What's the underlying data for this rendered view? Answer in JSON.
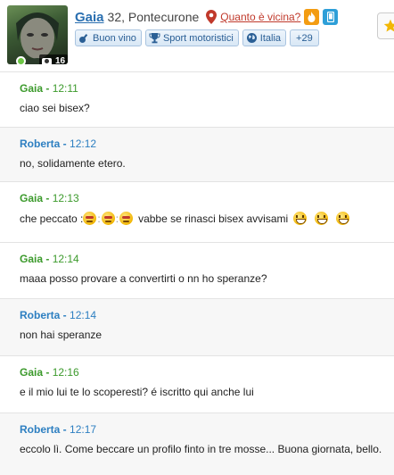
{
  "profile": {
    "username": "Gaia",
    "age_location": "32, Pontecurone",
    "nearby_link": "Quanto è vicina?",
    "photo_count": "16",
    "tags": [
      {
        "label": "Buon vino",
        "icon": "guitar-icon"
      },
      {
        "label": "Sport motoristici",
        "icon": "trophy-icon"
      },
      {
        "label": "Italia",
        "icon": "globe-icon"
      }
    ],
    "more_tags": "+29"
  },
  "colors": {
    "gaia": "#3c9a2c",
    "roberta": "#2d7fc1",
    "link": "#2a6fb0",
    "near_link": "#c0392b"
  },
  "messages": [
    {
      "sender": "Gaia",
      "time": "12:11",
      "text": "ciao sei bisex?"
    },
    {
      "sender": "Roberta",
      "time": "12:12",
      "text": "no, solidamente etero."
    },
    {
      "sender": "Gaia",
      "time": "12:13",
      "text_a": "che peccato :",
      "colon": ":",
      "text_b": "vabbe se rinasci bisex avvisami"
    },
    {
      "sender": "Gaia",
      "time": "12:14",
      "text": "maaa posso provare a convertirti o nn ho speranze?"
    },
    {
      "sender": "Roberta",
      "time": "12:14",
      "text": "non hai speranze"
    },
    {
      "sender": "Gaia",
      "time": "12:16",
      "text": "e il mio lui te lo scoperesti? é iscritto qui anche lui"
    },
    {
      "sender": "Roberta",
      "time": "12:17",
      "text": "eccolo lì. Come beccare un profilo finto in tre mosse... Buona giornata, bello."
    }
  ]
}
